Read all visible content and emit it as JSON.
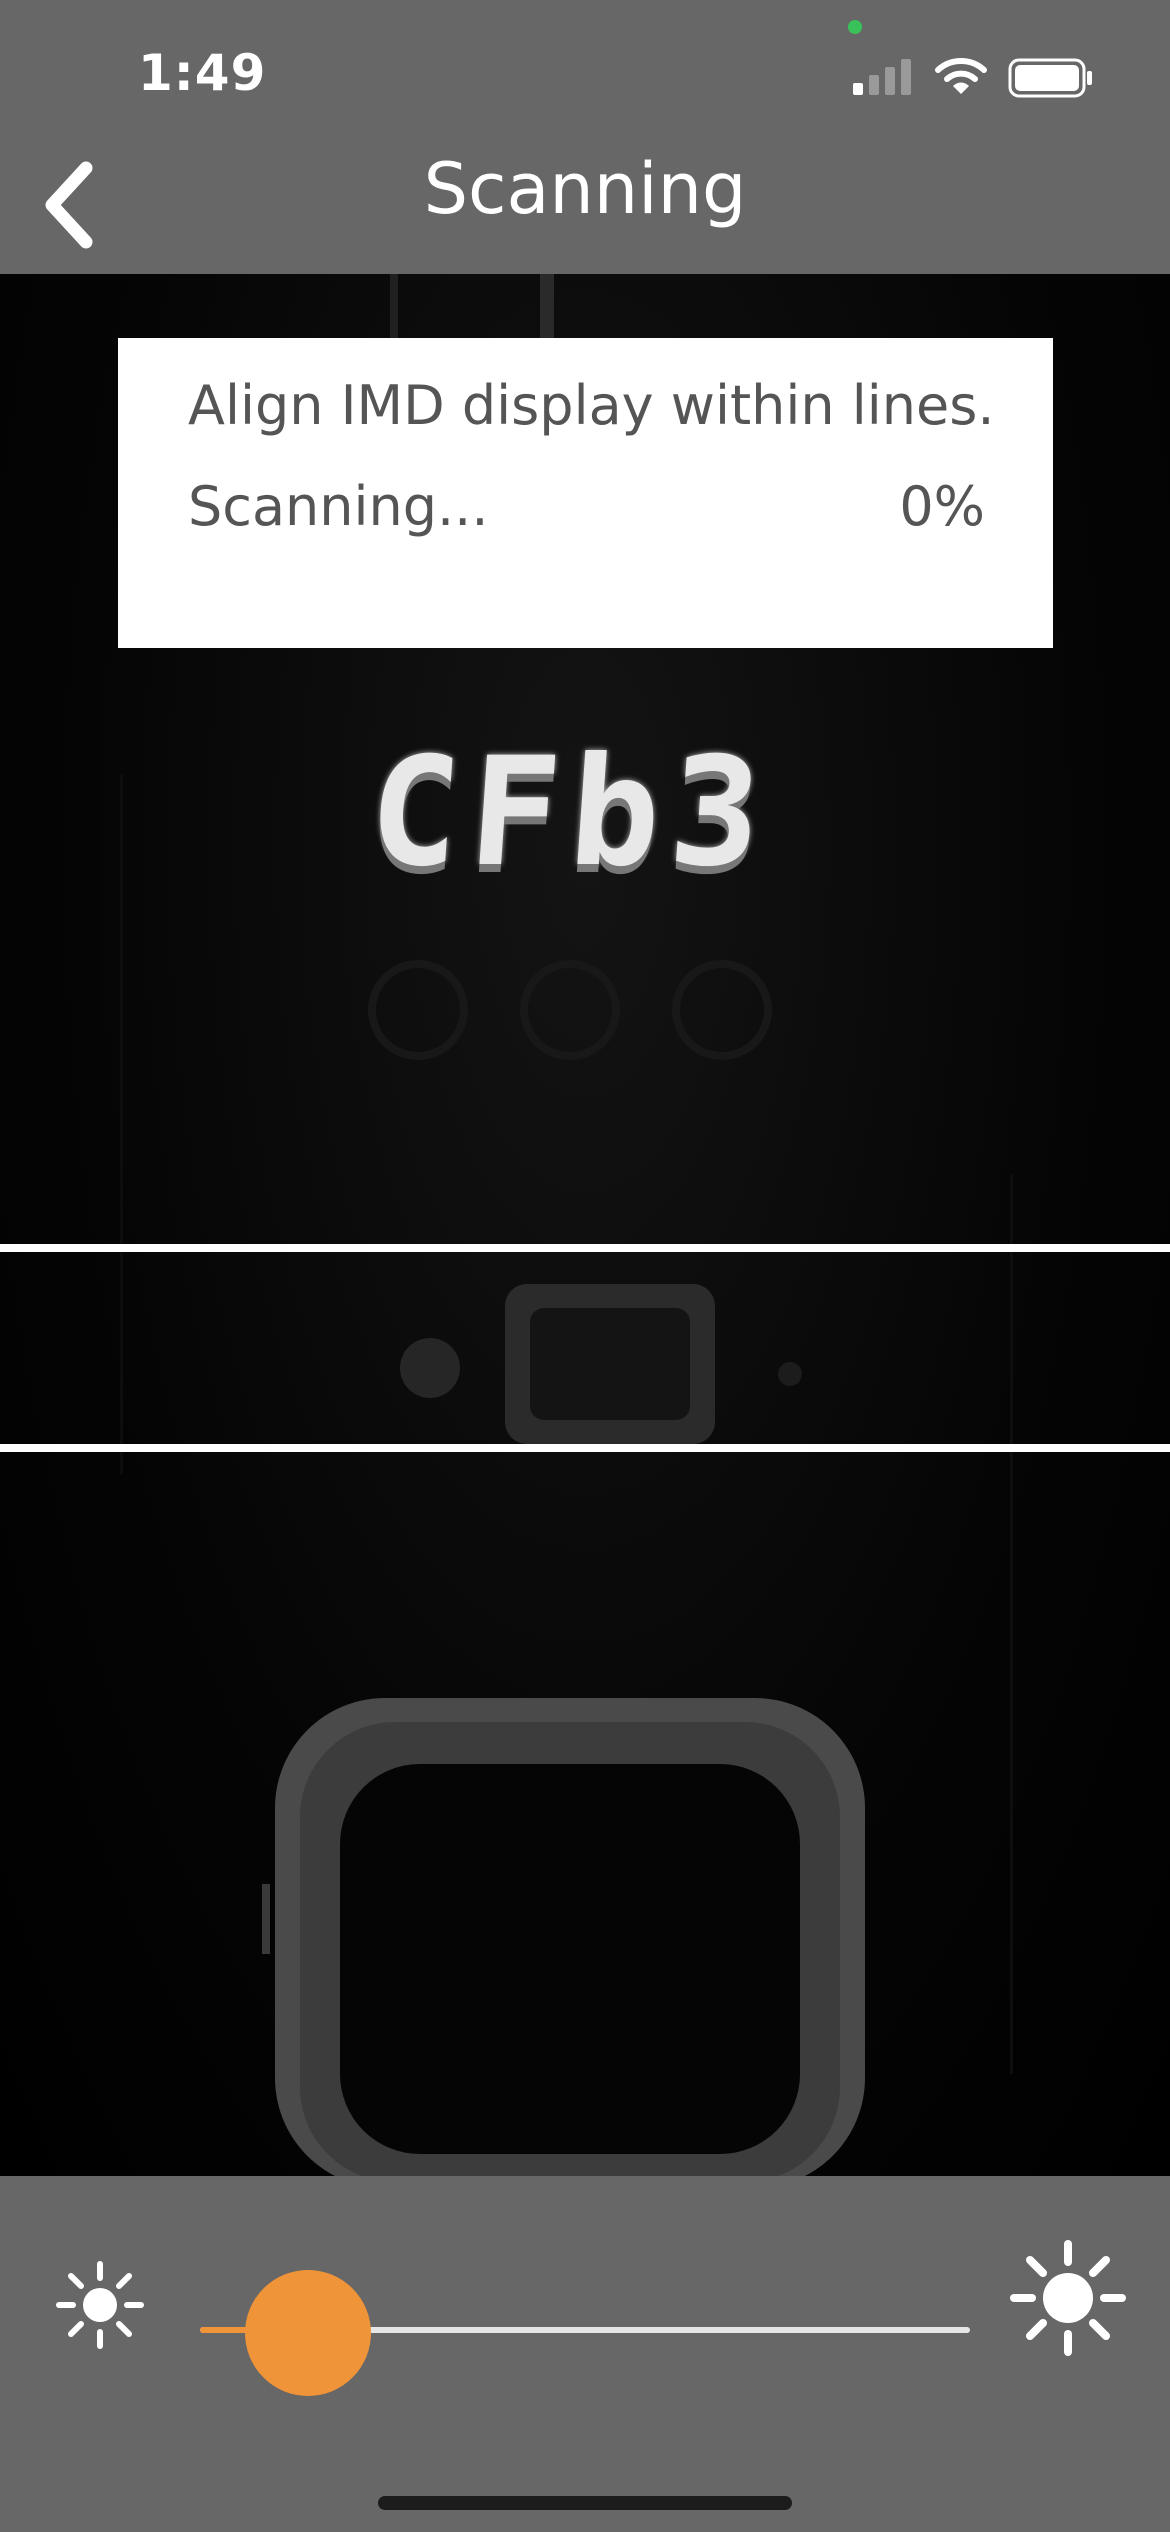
{
  "status_bar": {
    "time": "1:49",
    "icons": [
      "cellular-signal-icon",
      "wifi-icon",
      "battery-icon"
    ]
  },
  "nav": {
    "title": "Scanning",
    "back_icon": "chevron-left-icon"
  },
  "scan_card": {
    "instruction": "Align IMD display within lines.",
    "status_label": "Scanning...",
    "progress_text": "0%"
  },
  "camera": {
    "display_reading": "CFb3"
  },
  "brightness": {
    "min_icon": "sun-small-icon",
    "max_icon": "sun-large-icon",
    "level": 0.14
  },
  "colors": {
    "bar_background": "#676767",
    "accent": "#f0943a",
    "card_text": "#555555"
  }
}
